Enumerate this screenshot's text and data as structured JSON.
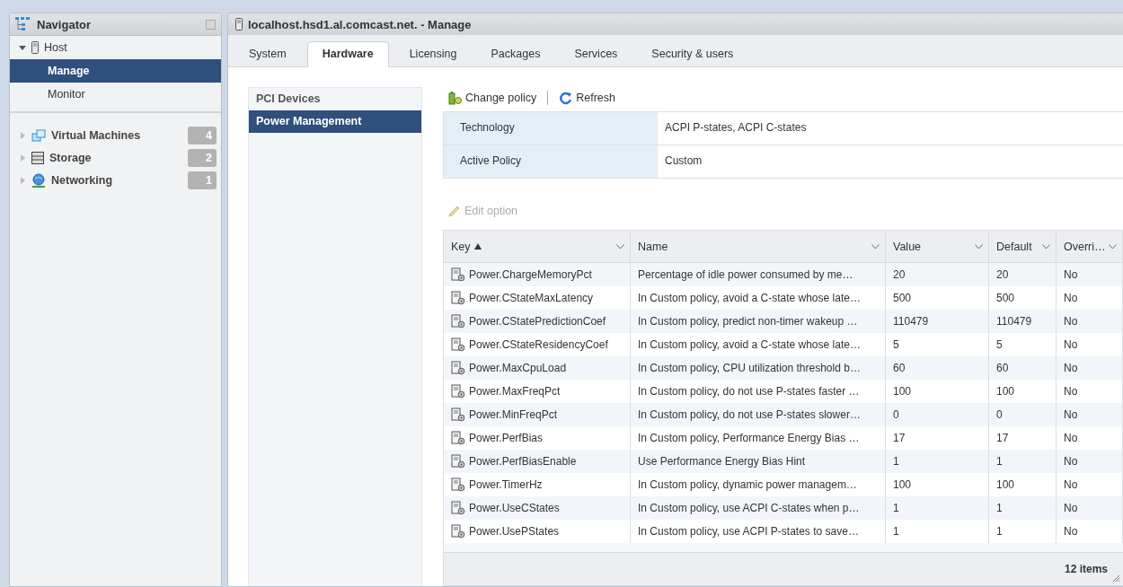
{
  "navigator": {
    "title": "Navigator",
    "tree": [
      {
        "label": "Host",
        "expanded": true,
        "children": [
          {
            "label": "Manage",
            "selected": true
          },
          {
            "label": "Monitor",
            "selected": false
          }
        ]
      }
    ],
    "items": [
      {
        "label": "Virtual Machines",
        "count": "4",
        "expanded": false
      },
      {
        "label": "Storage",
        "count": "2",
        "expanded": false
      },
      {
        "label": "Networking",
        "count": "1",
        "expanded": false
      }
    ]
  },
  "main": {
    "title": "localhost.hsd1.al.comcast.net. - Manage",
    "tabs": [
      {
        "label": "System",
        "selected": false
      },
      {
        "label": "Hardware",
        "selected": true
      },
      {
        "label": "Licensing",
        "selected": false
      },
      {
        "label": "Packages",
        "selected": false
      },
      {
        "label": "Services",
        "selected": false
      },
      {
        "label": "Security & users",
        "selected": false
      }
    ],
    "side_items": [
      {
        "label": "PCI Devices",
        "selected": false
      },
      {
        "label": "Power Management",
        "selected": true
      }
    ],
    "toolbar": [
      {
        "label": "Change policy",
        "disabled": false
      },
      {
        "label": "Refresh",
        "disabled": false
      }
    ],
    "properties": [
      {
        "label": "Technology",
        "value": "ACPI P-states, ACPI C-states"
      },
      {
        "label": "Active Policy",
        "value": "Custom"
      }
    ],
    "edit_option": {
      "label": "Edit option",
      "disabled": true
    },
    "table": {
      "columns": [
        {
          "label": "Key",
          "sorted": true
        },
        {
          "label": "Name",
          "sorted": false
        },
        {
          "label": "Value",
          "sorted": false
        },
        {
          "label": "Default",
          "sorted": false
        },
        {
          "label": "Overri…",
          "sorted": false
        }
      ],
      "rows": [
        {
          "key": "Power.ChargeMemoryPct",
          "name": "Percentage of idle power consumed by me…",
          "value": "20",
          "default": "20",
          "column_5": "No"
        },
        {
          "key": "Power.CStateMaxLatency",
          "name": "In Custom policy, avoid a C-state whose late…",
          "value": "500",
          "default": "500",
          "column_5": "No"
        },
        {
          "key": "Power.CStatePredictionCoef",
          "name": "In Custom policy, predict non-timer wakeup …",
          "value": "110479",
          "default": "110479",
          "column_5": "No"
        },
        {
          "key": "Power.CStateResidencyCoef",
          "name": "In Custom policy, avoid a C-state whose late…",
          "value": "5",
          "default": "5",
          "column_5": "No"
        },
        {
          "key": "Power.MaxCpuLoad",
          "name": "In Custom policy, CPU utilization threshold b…",
          "value": "60",
          "default": "60",
          "column_5": "No"
        },
        {
          "key": "Power.MaxFreqPct",
          "name": "In Custom policy, do not use P-states faster …",
          "value": "100",
          "default": "100",
          "column_5": "No"
        },
        {
          "key": "Power.MinFreqPct",
          "name": "In Custom policy, do not use P-states slower…",
          "value": "0",
          "default": "0",
          "column_5": "No"
        },
        {
          "key": "Power.PerfBias",
          "name": "In Custom policy, Performance Energy Bias …",
          "value": "17",
          "default": "17",
          "column_5": "No"
        },
        {
          "key": "Power.PerfBiasEnable",
          "name": "Use Performance Energy Bias Hint",
          "value": "1",
          "default": "1",
          "column_5": "No"
        },
        {
          "key": "Power.TimerHz",
          "name": "In Custom policy, dynamic power managem…",
          "value": "100",
          "default": "100",
          "column_5": "No"
        },
        {
          "key": "Power.UseCStates",
          "name": "In Custom policy, use ACPI C-states when p…",
          "value": "1",
          "default": "1",
          "column_5": "No"
        },
        {
          "key": "Power.UsePStates",
          "name": "In Custom policy, use ACPI P-states to save…",
          "value": "1",
          "default": "1",
          "column_5": "No"
        }
      ],
      "footer": "12 items"
    }
  }
}
